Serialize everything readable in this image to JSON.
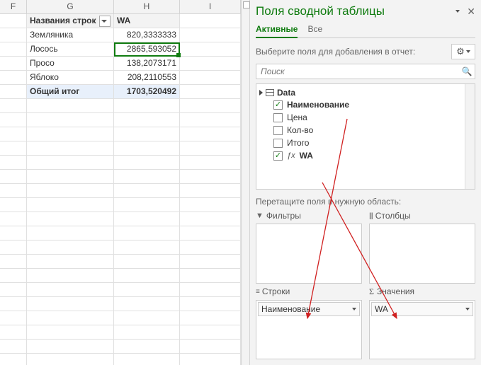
{
  "cols": {
    "F": "F",
    "G": "G",
    "H": "H",
    "I": "I"
  },
  "pivot": {
    "header_rows": "Названия строк",
    "header_val": "WA",
    "rows": [
      {
        "label": "Земляника",
        "value": "820,3333333"
      },
      {
        "label": "Лосось",
        "value": "2865,593052"
      },
      {
        "label": "Просо",
        "value": "138,2073171"
      },
      {
        "label": "Яблоко",
        "value": "208,2110553"
      }
    ],
    "total_label": "Общий итог",
    "total_value": "1703,520492"
  },
  "panel": {
    "title": "Поля сводной таблицы",
    "tabs": {
      "active": "Активные",
      "all": "Все"
    },
    "instruction": "Выберите поля для добавления в отчет:",
    "search_placeholder": "Поиск",
    "fields_root": "Data",
    "fields": [
      {
        "label": "Наименование",
        "checked": true,
        "fx": false,
        "bold": true
      },
      {
        "label": "Цена",
        "checked": false,
        "fx": false,
        "bold": false
      },
      {
        "label": "Кол-во",
        "checked": false,
        "fx": false,
        "bold": false
      },
      {
        "label": "Итого",
        "checked": false,
        "fx": false,
        "bold": false
      },
      {
        "label": "WA",
        "checked": true,
        "fx": true,
        "bold": true
      }
    ],
    "drag_hint": "Перетащите поля в нужную область:",
    "zones": {
      "filters": "Фильтры",
      "columns": "Столбцы",
      "rows": "Строки",
      "values": "Значения"
    },
    "row_item": "Наименование",
    "value_item": "WA"
  }
}
